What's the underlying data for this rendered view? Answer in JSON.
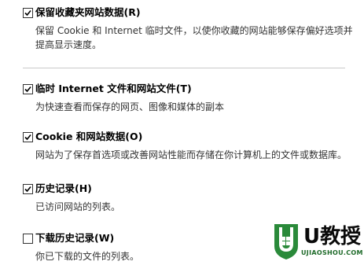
{
  "options": [
    {
      "label": "保留收藏夹网站数据(R)",
      "checked": true,
      "description": "保留 Cookie 和 Internet 临时文件，以使你收藏的网站能够保存偏好选项并提高显示速度。"
    },
    {
      "label": "临时 Internet 文件和网站文件(T)",
      "checked": true,
      "description": "为快速查看而保存的网页、图像和媒体的副本"
    },
    {
      "label": "Cookie 和网站数据(O)",
      "checked": true,
      "description": "网站为了保存首选项或改善网站性能而存储在你计算机上的文件或数据库。"
    },
    {
      "label": "历史记录(H)",
      "checked": true,
      "description": "已访问网站的列表。"
    },
    {
      "label": "下载历史记录(W)",
      "checked": false,
      "description": "你已下载的文件的列表。"
    }
  ],
  "watermark": {
    "brand": "U教授",
    "url": "UJIAOSHOU.COM",
    "color": "#2a8a3a"
  }
}
